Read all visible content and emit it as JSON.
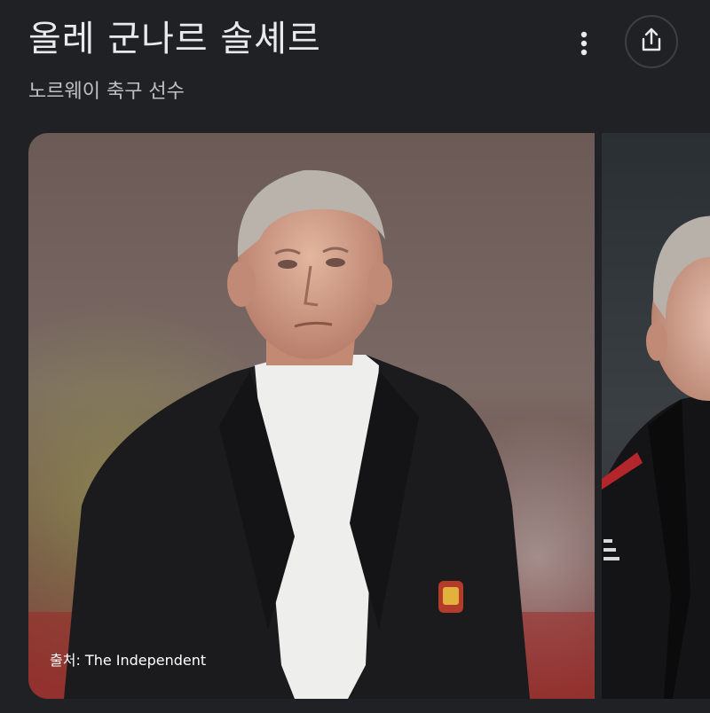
{
  "header": {
    "title": "올레 군나르 솔셰르",
    "subtitle": "노르웨이 축구 선수"
  },
  "actions": {
    "more_icon": "more-vert-icon",
    "share_icon": "share-icon"
  },
  "images": [
    {
      "caption": "출처: The Independent"
    },
    {
      "caption": ""
    }
  ],
  "colors": {
    "background": "#202124",
    "title": "#e8eaed",
    "subtitle": "#bdc1c6",
    "share_border": "#3c4043"
  }
}
